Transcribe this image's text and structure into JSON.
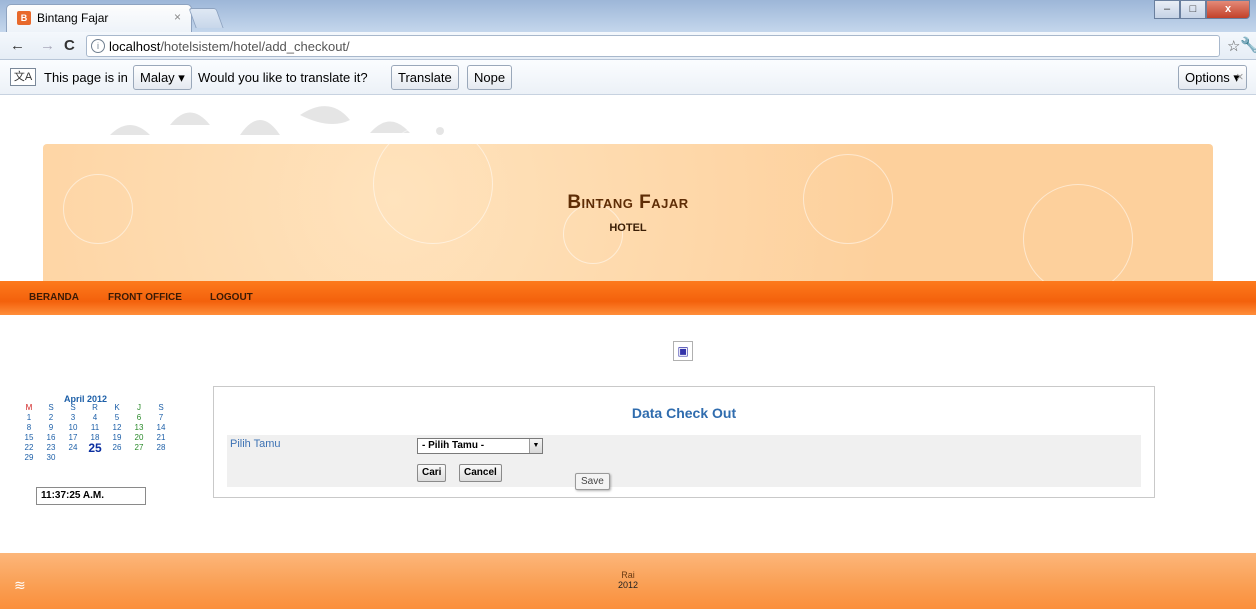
{
  "browser": {
    "tab_title": "Bintang Fajar",
    "tab_close": "×",
    "url_host": "localhost",
    "url_path": "/hotelsistem/hotel/add_checkout/",
    "window_controls": {
      "minimize": "–",
      "maximize": "□",
      "close": "x"
    }
  },
  "infobar": {
    "text_prefix": "This page is in",
    "language": "Malay ▾",
    "question": "Would you like to translate it?",
    "translate_label": "Translate",
    "nope_label": "Nope",
    "options_label": "Options ▾",
    "close": "×"
  },
  "site": {
    "title": "Bintang Fajar",
    "subtitle": "HOTEL"
  },
  "nav": {
    "items": [
      "BERANDA",
      "FRONT OFFICE",
      "LOGOUT"
    ]
  },
  "calendar": {
    "month_label": "April 2012",
    "weekdays": [
      "M",
      "S",
      "S",
      "R",
      "K",
      "J",
      "S"
    ],
    "rows": [
      [
        "1",
        "2",
        "3",
        "4",
        "5",
        "6",
        "7"
      ],
      [
        "8",
        "9",
        "10",
        "11",
        "12",
        "13",
        "14"
      ],
      [
        "15",
        "16",
        "17",
        "18",
        "19",
        "20",
        "21"
      ],
      [
        "22",
        "23",
        "24",
        "25",
        "26",
        "27",
        "28"
      ],
      [
        "29",
        "30",
        "",
        "",
        "",
        "",
        ""
      ]
    ],
    "today": "25",
    "clock": "11:37:25 A.M."
  },
  "form": {
    "title": "Data Check Out",
    "guest_label": "Pilih Tamu",
    "guest_select_value": "- Pilih Tamu -",
    "search_button": "Cari",
    "cancel_button": "Cancel",
    "save_button": "Save"
  },
  "footer": {
    "name": "Rai",
    "year": "2012"
  },
  "colors": {
    "banner": "#fccf9b",
    "navbar": "#f3610c",
    "footer": "#fa9e52",
    "title_blue": "#2f6cae"
  }
}
